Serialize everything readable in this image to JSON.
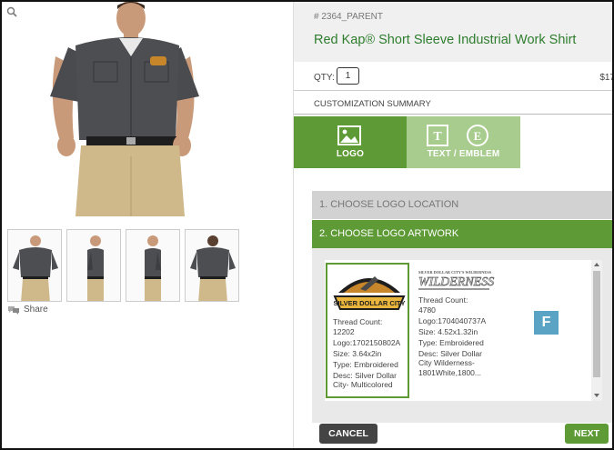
{
  "product": {
    "sku": "# 2364_PARENT",
    "title": "Red Kap® Short Sleeve Industrial Work Shirt",
    "qty_label": "QTY:",
    "qty_value": "1",
    "price": "$17",
    "share_label": "Share"
  },
  "customization": {
    "summary_label": "CUSTOMIZATION SUMMARY",
    "tabs": [
      {
        "label": "LOGO",
        "icon": "image-icon",
        "active": true
      },
      {
        "label": "TEXT / EMBLEM",
        "icons": [
          "text-icon",
          "emblem-icon"
        ],
        "active": false
      }
    ],
    "steps": [
      {
        "label": "1. CHOOSE LOGO LOCATION"
      },
      {
        "label": "2. CHOOSE LOGO ARTWORK"
      }
    ]
  },
  "logos": [
    {
      "artwork_text": "SILVER DOLLAR CITY",
      "thread_label": "Thread Count:",
      "thread_value": "12202",
      "logo_id": "Logo:1702150802A",
      "size": "Size: 3.64x2in",
      "type": "Type: Embroidered",
      "desc": "Desc: Silver Dollar City- Multicolored"
    },
    {
      "artwork_text": "SILVER DOLLAR CITY'S WILDERNESS",
      "thread_label": "Thread Count:",
      "thread_value": "4780",
      "logo_id": "Logo:1704040737A",
      "size": "Size: 4.52x1.32in",
      "type": "Type: Embroidered",
      "desc": "Desc: Silver Dollar City Wilderness-1801White,1800..."
    }
  ],
  "badge": "F",
  "buttons": {
    "cancel": "CANCEL",
    "next": "NEXT"
  },
  "colors": {
    "brand_green": "#5e9a35",
    "title_green": "#2e7d2e",
    "inactive_tab": "#a8cc8e",
    "badge_blue": "#5ba3c4"
  }
}
